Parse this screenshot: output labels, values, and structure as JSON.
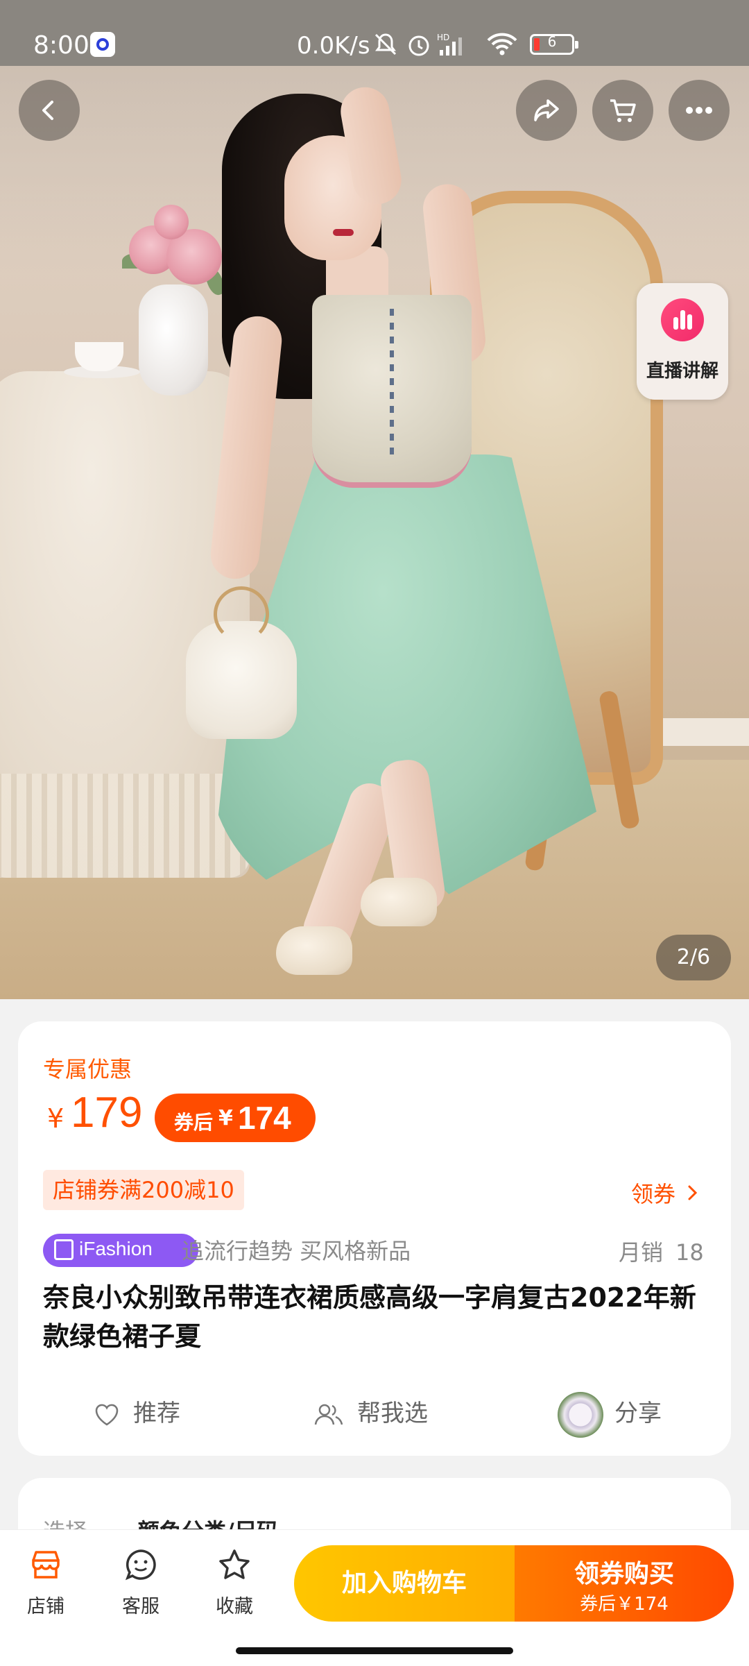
{
  "status_bar": {
    "time": "8:00",
    "net_speed": "0.0K/s",
    "battery": "6"
  },
  "hero": {
    "pager": "2/6",
    "live_label": "直播讲解"
  },
  "product": {
    "promo_label": "专属优惠",
    "currency": "¥",
    "price": "179",
    "after_coupon_label": "券后",
    "after_coupon_currency": "¥",
    "after_coupon_price": "174",
    "store_coupon": "店铺券满200减10",
    "get_coupon": "领券",
    "brand_tag": "iFashion",
    "slogan": "追流行趋势 买风格新品",
    "monthly_sales_label": "月销",
    "monthly_sales": "18",
    "title": "奈良小众别致吊带连衣裙质感高级一字肩复古2022年新款绿色裙子夏"
  },
  "actions": {
    "recommend": "推荐",
    "help_choose": "帮我选",
    "share": "分享"
  },
  "select_card": {
    "label": "选择",
    "options": "颜色分类/尺码"
  },
  "bottom_bar": {
    "store": "店铺",
    "service": "客服",
    "favorite": "收藏",
    "add_cart": "加入购物车",
    "buy": "领券购买",
    "buy_sub": "券后￥174"
  },
  "colors": {
    "accent": "#ff5000",
    "cart_button": "#ffb800",
    "ifashion": "#8d59f3"
  }
}
